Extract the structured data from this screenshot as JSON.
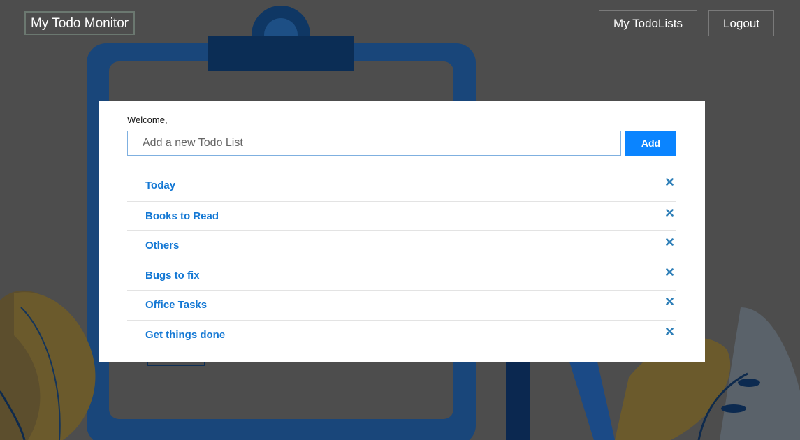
{
  "header": {
    "brand": "My Todo Monitor",
    "nav": {
      "my_todolists": "My TodoLists",
      "logout": "Logout"
    }
  },
  "main": {
    "welcome": "Welcome,",
    "new_list_input": {
      "placeholder": "Add a new Todo List",
      "value": ""
    },
    "add_button": "Add",
    "lists": [
      {
        "label": "Today",
        "delete_icon": "close-icon"
      },
      {
        "label": "Books to Read",
        "delete_icon": "close-icon"
      },
      {
        "label": "Others",
        "delete_icon": "close-icon"
      },
      {
        "label": "Bugs to fix",
        "delete_icon": "close-icon"
      },
      {
        "label": "Office Tasks",
        "delete_icon": "close-icon"
      },
      {
        "label": "Get things done",
        "delete_icon": "close-icon"
      }
    ]
  },
  "colors": {
    "overlay_bg": "#4d4d4d",
    "accent": "#0a84ff",
    "link": "#1478d4",
    "icon": "#2f7fb8"
  }
}
